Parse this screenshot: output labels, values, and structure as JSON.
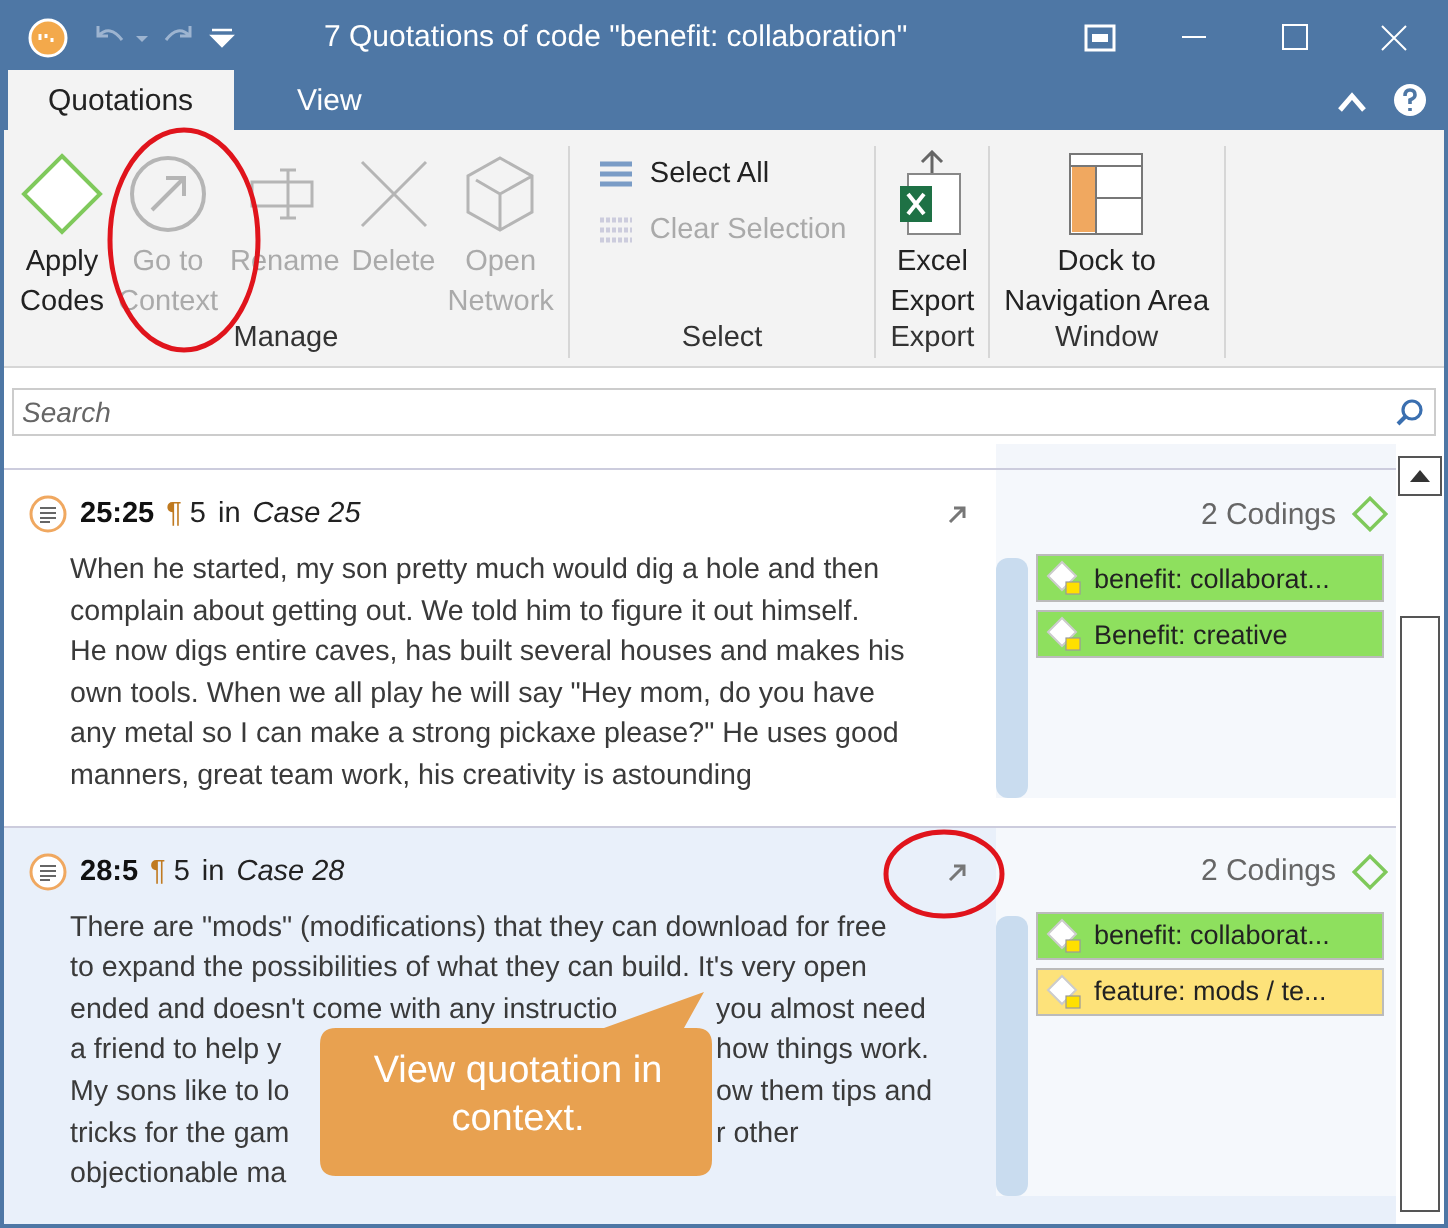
{
  "window": {
    "title": "7 Quotations of code \"benefit: collaboration\""
  },
  "tabs": [
    {
      "label": "Quotations",
      "selected": true
    },
    {
      "label": "View",
      "selected": false
    }
  ],
  "ribbon": {
    "groups": [
      {
        "label": "Manage",
        "buttons": [
          {
            "kind": "apply",
            "label": "Apply\nCodes",
            "disabled": false
          },
          {
            "kind": "context",
            "label": "Go to\nContext",
            "disabled": true
          },
          {
            "kind": "rename",
            "label": "Rename",
            "disabled": true
          },
          {
            "kind": "delete",
            "label": "Delete",
            "disabled": true
          },
          {
            "kind": "network",
            "label": "Open\nNetwork",
            "disabled": true
          }
        ]
      },
      {
        "label": "Select",
        "small": [
          {
            "label": "Select All",
            "disabled": false
          },
          {
            "label": "Clear Selection",
            "disabled": true
          }
        ]
      },
      {
        "label": "Export",
        "buttons": [
          {
            "kind": "excel",
            "label": "Excel\nExport",
            "disabled": false
          }
        ]
      },
      {
        "label": "Window",
        "buttons": [
          {
            "kind": "dock",
            "label": "Dock to\nNavigation Area",
            "disabled": false
          }
        ]
      }
    ]
  },
  "search": {
    "placeholder": "Search"
  },
  "quotations": [
    {
      "ref": "25:25",
      "para": "¶ 5",
      "in": "in",
      "case": "Case 25",
      "selected": false,
      "codings_count": "2 Codings",
      "lines": [
        [
          "When he started, my son pretty much would dig a hole and then"
        ],
        [
          "complain about getting out. We told him to figure it out himself."
        ],
        [
          "He now digs entire caves, has built several houses and makes his"
        ],
        [
          "own tools. When we all play he will say \"Hey mom, do you have"
        ],
        [
          "any metal so I can make a strong pickaxe please?\" He uses good"
        ],
        [
          "manners, great team work, his creativity is astounding"
        ]
      ],
      "codings": [
        {
          "label": "benefit: collaborat...",
          "color": "#8ee05e"
        },
        {
          "label": "Benefit: creative",
          "color": "#8ee05e"
        }
      ]
    },
    {
      "ref": "28:5",
      "para": "¶ 5",
      "in": "in",
      "case": "Case 28",
      "selected": true,
      "codings_count": "2 Codings",
      "lines": [
        [
          "There are \"mods\" (modifications) that they can download for free"
        ],
        [
          "to expand the possibilities of what they can build. It's very open"
        ],
        [
          "ended and doesn't come with any instructio",
          "you almost need"
        ],
        [
          "a friend to help y",
          "how things work."
        ],
        [
          "My sons like to lo",
          "ow them tips and"
        ],
        [
          "tricks for the gam",
          "r other"
        ],
        [
          "objectionable ma"
        ]
      ],
      "codings": [
        {
          "label": "benefit: collaborat...",
          "color": "#8ee05e"
        },
        {
          "label": "feature: mods / te...",
          "color": "#fde27a"
        }
      ]
    }
  ],
  "callout": {
    "text": "View quotation in context."
  }
}
